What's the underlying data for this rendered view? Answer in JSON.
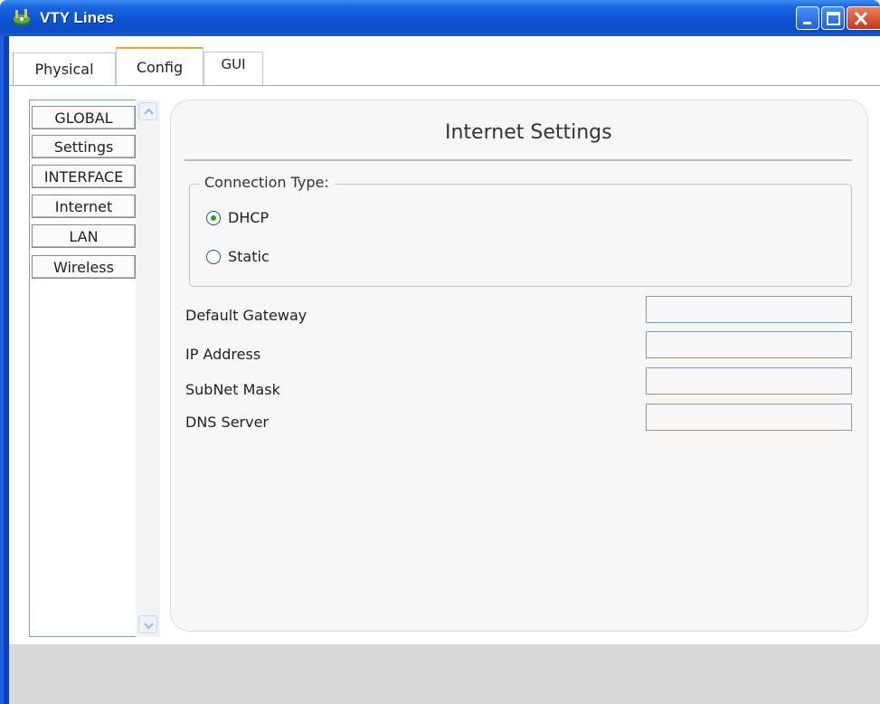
{
  "window": {
    "title": "VTY Lines"
  },
  "tabs": [
    {
      "label": "Physical"
    },
    {
      "label": "Config"
    },
    {
      "label": "GUI"
    }
  ],
  "sidebar": {
    "items": [
      {
        "label": "GLOBAL"
      },
      {
        "label": "Settings"
      },
      {
        "label": "INTERFACE"
      },
      {
        "label": "Internet"
      },
      {
        "label": "LAN"
      },
      {
        "label": "Wireless"
      }
    ]
  },
  "main": {
    "title": "Internet Settings",
    "connection_type": {
      "legend": "Connection Type:",
      "options": [
        {
          "label": "DHCP",
          "selected": true
        },
        {
          "label": "Static",
          "selected": false
        }
      ]
    },
    "fields": [
      {
        "label": "Default Gateway",
        "value": ""
      },
      {
        "label": "IP Address",
        "value": ""
      },
      {
        "label": "SubNet Mask",
        "value": ""
      },
      {
        "label": "DNS Server",
        "value": ""
      }
    ]
  },
  "colors": {
    "titlebar": "#0b54d6",
    "active_tab_accent": "#f5a623",
    "radio_selected": "#21a121"
  }
}
